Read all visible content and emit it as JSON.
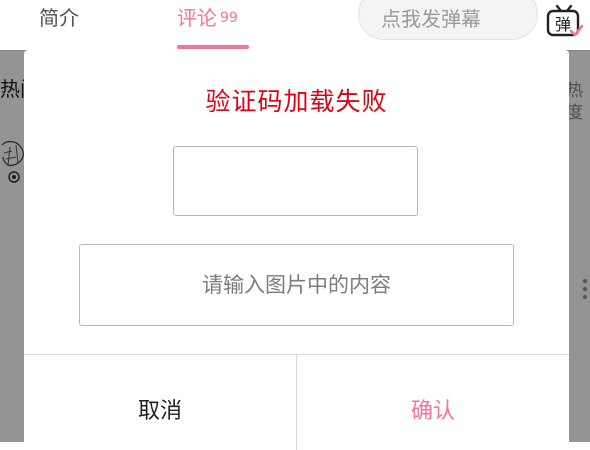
{
  "tabs": [
    {
      "label": "简介"
    },
    {
      "label": "评论",
      "count": "99"
    }
  ],
  "danmaku": {
    "placeholder": "点我发弹幕",
    "toggle_icon_label": "弹"
  },
  "background_content": {
    "left_text": "热门",
    "right_text": "热度"
  },
  "dialog": {
    "title": "验证码加载失败",
    "input_placeholder": "请输入图片中的内容",
    "input_value": "",
    "cancel_label": "取消",
    "confirm_label": "确认"
  },
  "colors": {
    "accent_pink": "#fb7299",
    "error_red": "#e50012"
  },
  "icons": [
    "danmaku-toggle-icon",
    "more-options-icon"
  ]
}
